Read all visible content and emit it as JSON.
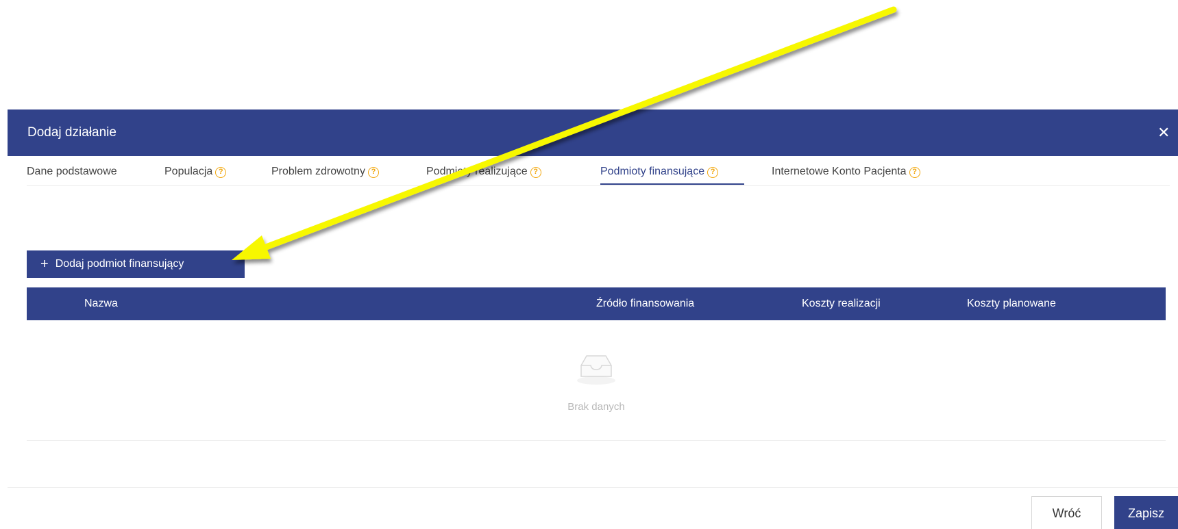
{
  "modal": {
    "title": "Dodaj działanie",
    "close_icon": "close-icon"
  },
  "tabs": [
    {
      "label": "Dane podstawowe",
      "help": false,
      "active": false
    },
    {
      "label": "Populacja",
      "help": true,
      "active": false
    },
    {
      "label": "Problem zdrowotny",
      "help": true,
      "active": false
    },
    {
      "label": "Podmioty realizujące",
      "help": true,
      "active": false
    },
    {
      "label": "Podmioty finansujące",
      "help": true,
      "active": true
    },
    {
      "label": "Internetowe Konto Pacjenta",
      "help": true,
      "active": false
    }
  ],
  "help_glyph": "?",
  "add_button": {
    "icon": "plus-icon",
    "label": "Dodaj podmiot finansujący"
  },
  "table": {
    "columns": [
      "Nazwa",
      "Źródło finansowania",
      "Koszty realizacji",
      "Koszty planowane"
    ],
    "rows": [],
    "empty_text": "Brak danych"
  },
  "footer": {
    "back_label": "Wróć",
    "save_label": "Zapisz"
  },
  "colors": {
    "primary": "#31428a",
    "help": "#f2a70d",
    "annotation_arrow": "#f7f700"
  }
}
